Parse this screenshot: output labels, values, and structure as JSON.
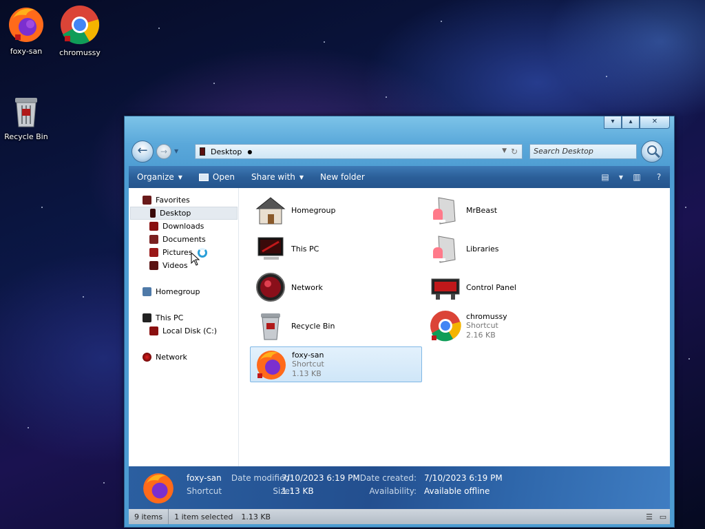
{
  "desktop": {
    "icons": [
      {
        "label": "foxy-san",
        "icon": "firefox-icon"
      },
      {
        "label": "chromussy",
        "icon": "chrome-icon"
      },
      {
        "label": "Recycle Bin",
        "icon": "recycle-bin-icon"
      }
    ]
  },
  "window": {
    "caption": {
      "minimize": "▾",
      "maximize": "▴",
      "close": "✕"
    },
    "address": {
      "location": "Desktop"
    },
    "search": {
      "placeholder": "Search Desktop"
    },
    "toolbar": {
      "organize": "Organize",
      "open": "Open",
      "share_with": "Share with",
      "new_folder": "New folder"
    },
    "nav": {
      "favorites": "Favorites",
      "desktop": "Desktop",
      "downloads": "Downloads",
      "documents": "Documents",
      "pictures": "Pictures",
      "videos": "Videos",
      "homegroup": "Homegroup",
      "this_pc": "This PC",
      "local_disk": "Local Disk (C:)",
      "network": "Network"
    },
    "files": [
      {
        "name": "Homegroup",
        "icon": "homegroup-icon"
      },
      {
        "name": "MrBeast",
        "icon": "user-folder-icon"
      },
      {
        "name": "This PC",
        "icon": "computer-icon"
      },
      {
        "name": "Libraries",
        "icon": "libraries-icon"
      },
      {
        "name": "Network",
        "icon": "network-icon"
      },
      {
        "name": "Control Panel",
        "icon": "control-panel-icon"
      },
      {
        "name": "Recycle Bin",
        "icon": "recycle-bin-icon"
      },
      {
        "name": "chromussy",
        "type": "Shortcut",
        "size": "2.16 KB",
        "icon": "chrome-icon"
      },
      {
        "name": "foxy-san",
        "type": "Shortcut",
        "size": "1.13 KB",
        "icon": "firefox-icon"
      }
    ],
    "details": {
      "name": "foxy-san",
      "type": "Shortcut",
      "date_modified_label": "Date modified:",
      "date_modified": "7/10/2023 6:19 PM",
      "size_label": "Size:",
      "size": "1.13 KB",
      "date_created_label": "Date created:",
      "date_created": "7/10/2023 6:19 PM",
      "availability_label": "Availability:",
      "availability": "Available offline"
    },
    "status": {
      "items": "9 items",
      "selected": "1 item selected",
      "selected_size": "1.13 KB"
    }
  },
  "colors": {
    "toolbar": "#2b5f99",
    "details_bar": "#234f8f",
    "selection": "#cfe6f8"
  }
}
